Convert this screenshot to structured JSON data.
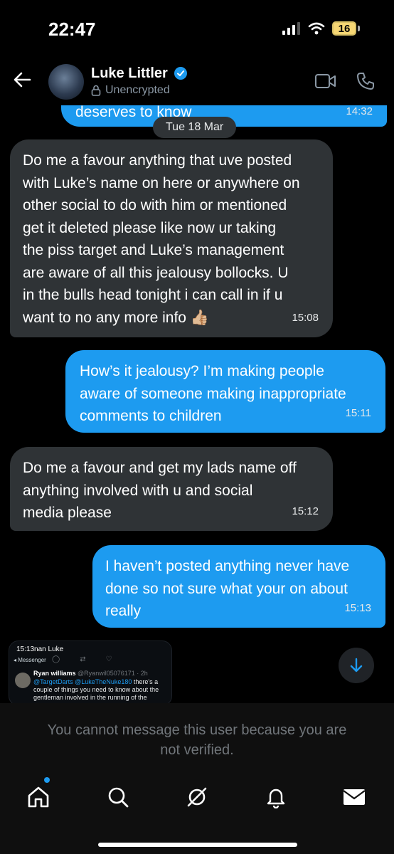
{
  "status_bar": {
    "time": "22:47",
    "battery": "16"
  },
  "header": {
    "contact_name": "Luke Littler",
    "encryption_status": "Unencrypted",
    "icons": [
      "back-arrow-icon",
      "verified-badge-icon",
      "lock-icon",
      "video-call-icon",
      "phone-call-icon"
    ]
  },
  "chat": {
    "date_separator": "Tue 18 Mar",
    "messages": [
      {
        "direction": "outgoing",
        "text": "deserves to know",
        "time": "14:32"
      },
      {
        "direction": "incoming",
        "text": "Do me a favour anything that uve posted\nwith Luke’s name on here or anywhere on\nother social to do with him or mentioned\nget it deleted please like now ur taking\nthe piss target and Luke’s management\nare aware of all this jealousy bollocks. U\nin the bulls head tonight i can call in if u\nwant to no any more info 👍🏼",
        "time": "15:08"
      },
      {
        "direction": "outgoing",
        "text": "How’s it jealousy? I’m making people\naware of someone making inappropriate\ncomments to children",
        "time": "15:11"
      },
      {
        "direction": "incoming",
        "text": "Do me a favour and get my lads name off\nanything involved with u and social\nmedia please",
        "time": "15:12"
      },
      {
        "direction": "outgoing",
        "text": "I haven’t posted anything never have\ndone so not sure what your on about\nreally",
        "time": "15:13"
      }
    ],
    "shared_post": {
      "top_text": "15:13nan Luke",
      "back_label": "◂ Messenger",
      "author": "Ryan williams",
      "handle": "@Ryanwil05076171 · 2h",
      "mentions": "@TargetDarts @LukeTheNuke180",
      "body": " there's a couple of things you need to know about the gentleman involved in the running of the"
    }
  },
  "composer_notice": {
    "line1": "You cannot message this user because you are",
    "line2": "not verified."
  },
  "tabbar": {
    "items": [
      {
        "name": "home",
        "icon": "home-icon",
        "active": true
      },
      {
        "name": "search",
        "icon": "search-icon",
        "active": false
      },
      {
        "name": "grok",
        "icon": "grok-icon",
        "active": false
      },
      {
        "name": "notifications",
        "icon": "bell-icon",
        "active": false
      },
      {
        "name": "messages",
        "icon": "mail-icon",
        "active": false
      }
    ]
  },
  "colors": {
    "accent": "#1d9bf0",
    "incoming_bubble": "#2f3336",
    "background": "#000000"
  }
}
